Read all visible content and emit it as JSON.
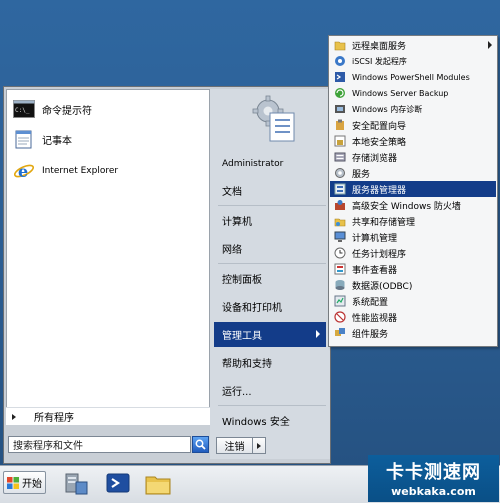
{
  "start_menu": {
    "pinned": [
      {
        "label": "命令提示符",
        "icon": "cmd-icon"
      },
      {
        "label": "记事本",
        "icon": "notepad-icon"
      },
      {
        "label": "Internet Explorer",
        "icon": "ie-icon"
      }
    ],
    "all_programs": "所有程序",
    "search_placeholder": "搜索程序和文件",
    "right_items": {
      "user": "Administrator",
      "documents": "文档",
      "computer": "计算机",
      "network": "网络",
      "control_panel": "控制面板",
      "devices": "设备和打印机",
      "admin_tools": "管理工具",
      "help": "帮助和支持",
      "run": "运行...",
      "security": "Windows 安全"
    },
    "shutdown_label": "注销"
  },
  "submenu": {
    "items": [
      {
        "label": "远程桌面服务",
        "icon": "folder-icon",
        "has_submenu": true
      },
      {
        "label": "iSCSI 发起程序",
        "icon": "iscsi-icon"
      },
      {
        "label": "Windows PowerShell Modules",
        "icon": "powershell-icon"
      },
      {
        "label": "Windows Server Backup",
        "icon": "backup-icon"
      },
      {
        "label": "Windows 内存诊断",
        "icon": "memory-icon"
      },
      {
        "label": "安全配置向导",
        "icon": "security-wizard-icon"
      },
      {
        "label": "本地安全策略",
        "icon": "local-policy-icon"
      },
      {
        "label": "存储浏览器",
        "icon": "storage-icon"
      },
      {
        "label": "服务",
        "icon": "services-icon"
      },
      {
        "label": "服务器管理器",
        "icon": "server-manager-icon",
        "active": true
      },
      {
        "label": "高级安全 Windows 防火墙",
        "icon": "firewall-icon"
      },
      {
        "label": "共享和存储管理",
        "icon": "share-icon"
      },
      {
        "label": "计算机管理",
        "icon": "computer-management-icon"
      },
      {
        "label": "任务计划程序",
        "icon": "task-scheduler-icon"
      },
      {
        "label": "事件查看器",
        "icon": "event-viewer-icon"
      },
      {
        "label": "数据源(ODBC)",
        "icon": "odbc-icon"
      },
      {
        "label": "系统配置",
        "icon": "msconfig-icon"
      },
      {
        "label": "性能监视器",
        "icon": "performance-icon"
      },
      {
        "label": "组件服务",
        "icon": "component-services-icon"
      }
    ]
  },
  "taskbar": {
    "start_label": "开始"
  },
  "watermark": {
    "title": "卡卡测速网",
    "url": "webkaka.com"
  },
  "colors": {
    "highlight": "#133c89",
    "desktop": "#2c5e93"
  }
}
